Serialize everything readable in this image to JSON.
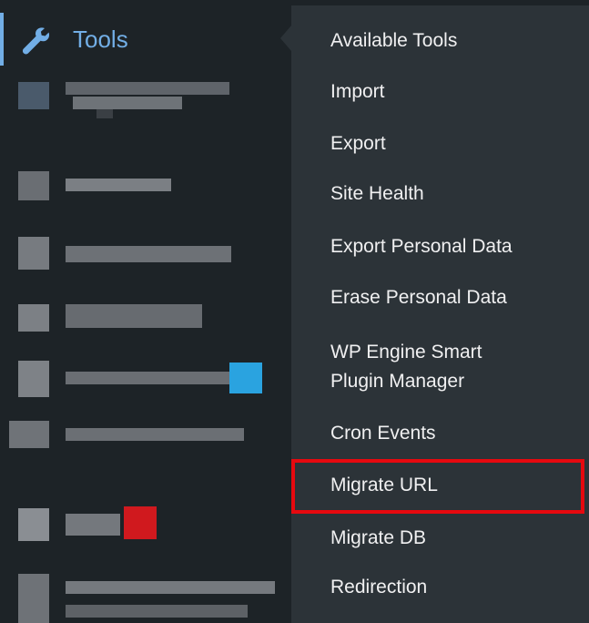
{
  "sidebar": {
    "active_item": {
      "label": "Tools",
      "icon": "wrench-icon"
    },
    "accent_color": "#72aee6",
    "background": "#1d2327"
  },
  "submenu": {
    "background": "#2c3338",
    "items": [
      {
        "label": "Available Tools"
      },
      {
        "label": "Import"
      },
      {
        "label": "Export"
      },
      {
        "label": "Site Health"
      },
      {
        "label": "Export Personal Data"
      },
      {
        "label": "Erase Personal Data"
      },
      {
        "label": "WP Engine Smart\nPlugin Manager"
      },
      {
        "label": "Cron Events"
      },
      {
        "label": "Migrate URL",
        "highlighted": true
      },
      {
        "label": "Migrate DB"
      },
      {
        "label": "Redirection"
      }
    ]
  },
  "annotation": {
    "highlight_color": "#e6090f"
  }
}
